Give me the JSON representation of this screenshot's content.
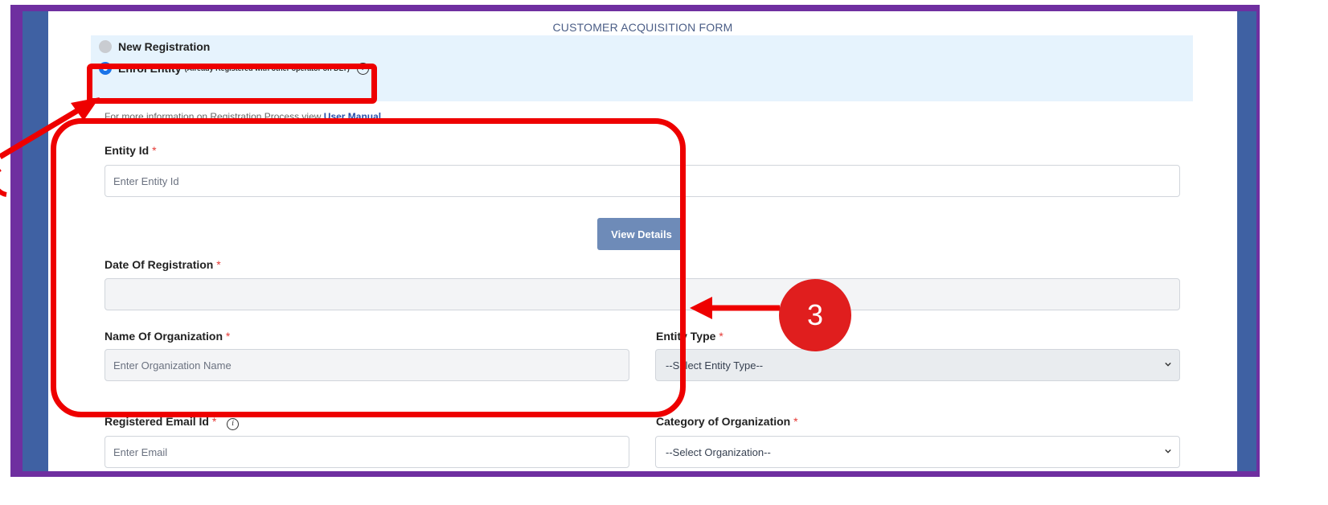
{
  "form": {
    "title": "CUSTOMER ACQUISITION FORM",
    "registration": {
      "new_label": "New Registration",
      "enrol_label": "Enrol Entity",
      "enrol_note": "(Already Registered with other operator on DLT)",
      "selected": "Enrol Entity"
    },
    "manual_note": "For more information on Registration Process view",
    "manual_link": "User Manual",
    "entity_id": {
      "label": "Entity Id",
      "required_mark": "*",
      "placeholder": "Enter Entity Id"
    },
    "view_details_button": "View Details",
    "date_of_registration": {
      "label": "Date Of Registration",
      "required_mark": "*",
      "value": ""
    },
    "name_of_organization": {
      "label": "Name Of Organization",
      "required_mark": "*",
      "placeholder": "Enter Organization Name"
    },
    "entity_type": {
      "label": "Entity Type",
      "required_mark": "*",
      "selected": "--Select Entity Type--"
    },
    "registered_email": {
      "label": "Registered Email Id",
      "required_mark": "*",
      "placeholder": "Enter Email"
    },
    "category_of_organization": {
      "label": "Category of Organization",
      "required_mark": "*",
      "selected": "--Select Organization--"
    }
  },
  "annotation": {
    "step_number": "3",
    "color": "#ee0000"
  },
  "colors": {
    "frame_purple": "#6f2fa0",
    "sidebar_blue": "#3f61a3",
    "panel_bg": "#e6f3fd",
    "radio_blue": "#1a73e8",
    "button": "#6e8bb8"
  }
}
